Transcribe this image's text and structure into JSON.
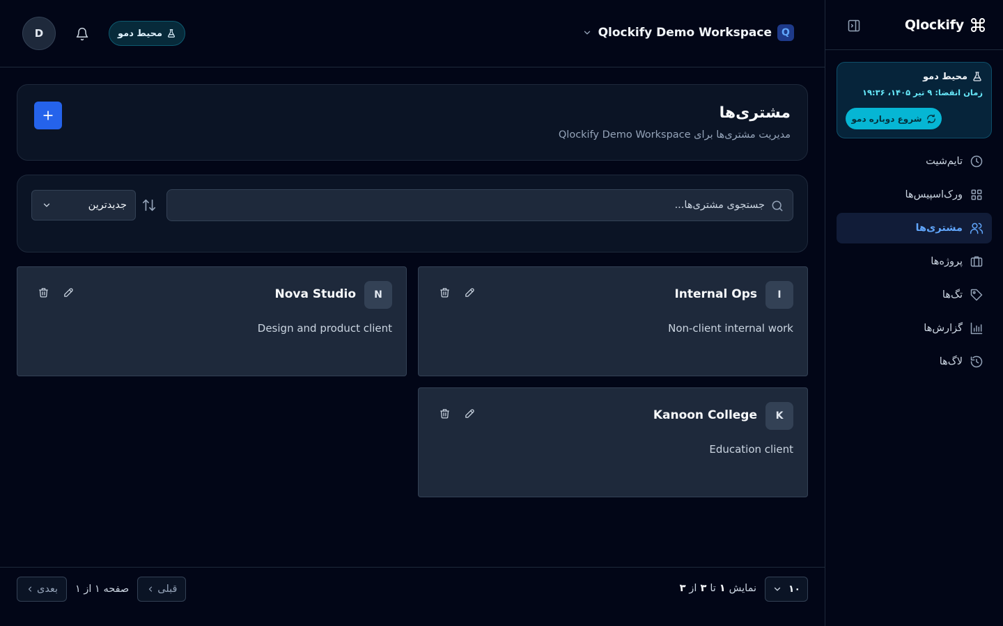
{
  "sidebar": {
    "brand": "Qlockify",
    "demo": {
      "title": "محیط دمو",
      "expiry": "زمان انقضا: ۹ تیر ۱۴۰۵، ۱۹:۳۶",
      "restart_label": "شروع دوباره دمو"
    },
    "items": [
      {
        "label": "تایم‌شیت",
        "icon": "clock-icon"
      },
      {
        "label": "ورک‌اسپیس‌ها",
        "icon": "grid-icon"
      },
      {
        "label": "مشتری‌ها",
        "icon": "users-icon",
        "active": true
      },
      {
        "label": "پروژه‌ها",
        "icon": "briefcase-icon"
      },
      {
        "label": "تگ‌ها",
        "icon": "tag-icon"
      },
      {
        "label": "گزارش‌ها",
        "icon": "bar-chart-icon"
      },
      {
        "label": "لاگ‌ها",
        "icon": "history-icon"
      }
    ]
  },
  "header": {
    "avatar_initial": "D",
    "demo_badge": "محیط دمو",
    "workspace_name": "Qlockify Demo Workspace",
    "workspace_initial": "Q"
  },
  "page": {
    "title": "مشتری‌ها",
    "subtitle": "مدیریت مشتری‌ها برای Qlockify Demo Workspace"
  },
  "filters": {
    "search_placeholder": "جستجوی مشتری‌ها...",
    "sort_label": "جدیدترین"
  },
  "clients": [
    {
      "initial": "I",
      "name": "Internal Ops",
      "description": "Non-client internal work"
    },
    {
      "initial": "N",
      "name": "Nova Studio",
      "description": "Design and product client"
    },
    {
      "initial": "K",
      "name": "Kanoon College",
      "description": "Education client"
    }
  ],
  "footer": {
    "page_size": "۱۰",
    "showing_prefix": "نمایش",
    "showing_from": "۱",
    "showing_to_word": "تا",
    "showing_to": "۳",
    "showing_of_word": "از",
    "showing_total": "۳",
    "prev_label": "قبلی",
    "page_info": "صفحه ۱ از ۱",
    "next_label": "بعدی"
  },
  "colors": {
    "background": "#020617",
    "card": "#1e293b",
    "accent": "#2563eb",
    "active_nav": "#60a5fa",
    "demo_cyan": "#06b6d4"
  }
}
